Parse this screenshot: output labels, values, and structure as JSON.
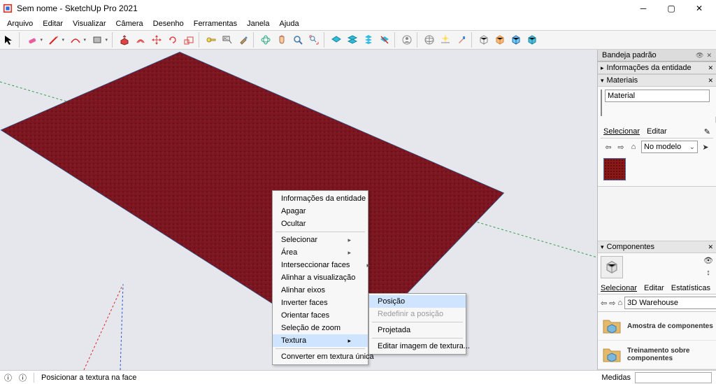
{
  "window": {
    "title": "Sem nome - SketchUp Pro 2021"
  },
  "menu": [
    "Arquivo",
    "Editar",
    "Visualizar",
    "Câmera",
    "Desenho",
    "Ferramentas",
    "Janela",
    "Ajuda"
  ],
  "status": {
    "hint": "Posicionar a textura na face",
    "measure_label": "Medidas"
  },
  "context": {
    "items": [
      {
        "label": "Informações da entidade"
      },
      {
        "label": "Apagar"
      },
      {
        "label": "Ocultar"
      },
      {
        "label": "Selecionar",
        "sub": true
      },
      {
        "label": "Área",
        "sub": true
      },
      {
        "label": "Interseccionar faces",
        "sub": true
      },
      {
        "label": "Alinhar a visualização"
      },
      {
        "label": "Alinhar eixos"
      },
      {
        "label": "Inverter faces"
      },
      {
        "label": "Orientar faces"
      },
      {
        "label": "Seleção de zoom"
      },
      {
        "label": "Textura",
        "sub": true,
        "hl": true
      },
      {
        "label": "Converter em textura única"
      }
    ],
    "submenu": [
      {
        "label": "Posição",
        "hl": true
      },
      {
        "label": "Redefinir a posição",
        "dis": true
      },
      {
        "label": "Projetada"
      },
      {
        "label": "Editar imagem de textura..."
      }
    ],
    "sep_after": [
      2,
      5,
      7
    ]
  },
  "tray": {
    "title": "Bandeja padrão",
    "panels": {
      "entity": "Informações da entidade",
      "materials": "Materiais",
      "components": "Componentes"
    },
    "material_name": "Material",
    "sel_tabs": {
      "select": "Selecionar",
      "edit": "Editar",
      "stats": "Estatísticas"
    },
    "in_model": "No modelo",
    "warehouse": "3D Warehouse",
    "comp_items": [
      "Amostra de componentes",
      "Treinamento sobre componentes"
    ]
  }
}
